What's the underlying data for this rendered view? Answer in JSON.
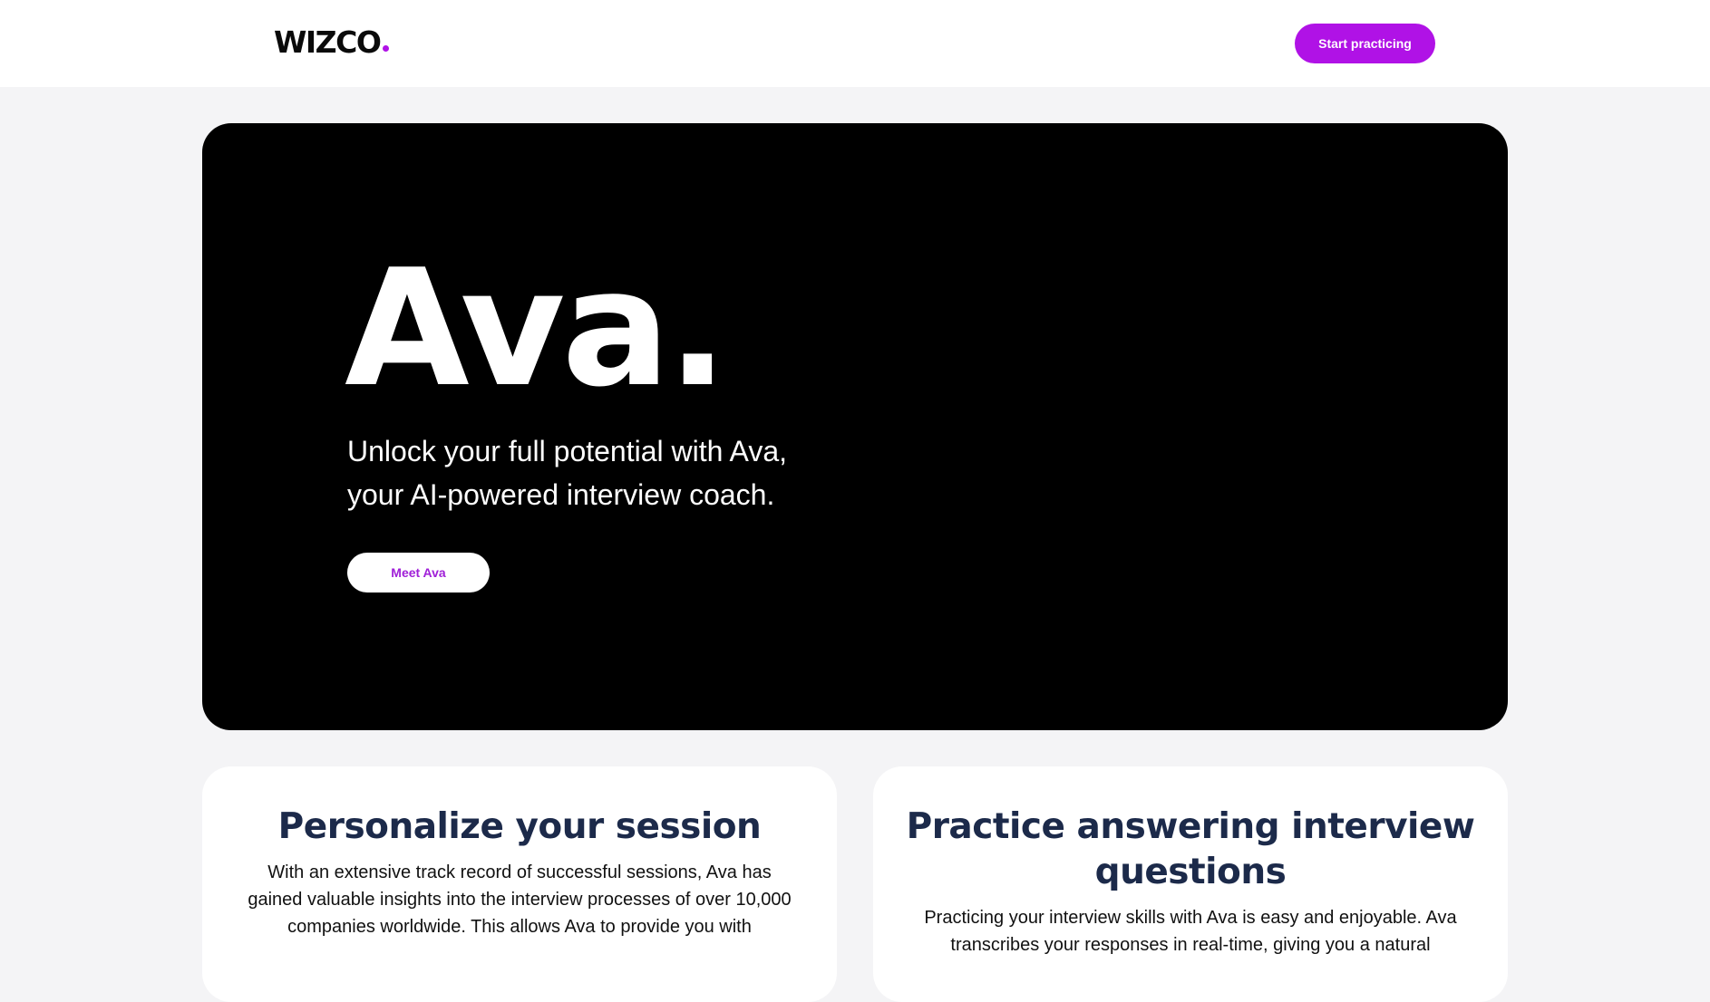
{
  "header": {
    "logo_text": "WIZCO",
    "cta_label": "Start practicing"
  },
  "hero": {
    "title": "Ava.",
    "subtitle_line1": "Unlock your full potential with Ava,",
    "subtitle_line2": "your AI-powered interview coach.",
    "cta_label": "Meet Ava"
  },
  "cards": [
    {
      "title": "Personalize your session",
      "body": "With an extensive track record of successful sessions, Ava has gained valuable insights into the interview processes of over 10,000 companies worldwide. This allows Ava to provide you with"
    },
    {
      "title": "Practice answering interview questions",
      "body": "Practicing your interview skills with Ava is easy and enjoyable. Ava transcribes your responses in real-time, giving you a natural"
    }
  ],
  "colors": {
    "accent": "#b012e6",
    "page_background": "#f4f4f6",
    "hero_background": "#000000",
    "card_title": "#1c2a4a"
  }
}
